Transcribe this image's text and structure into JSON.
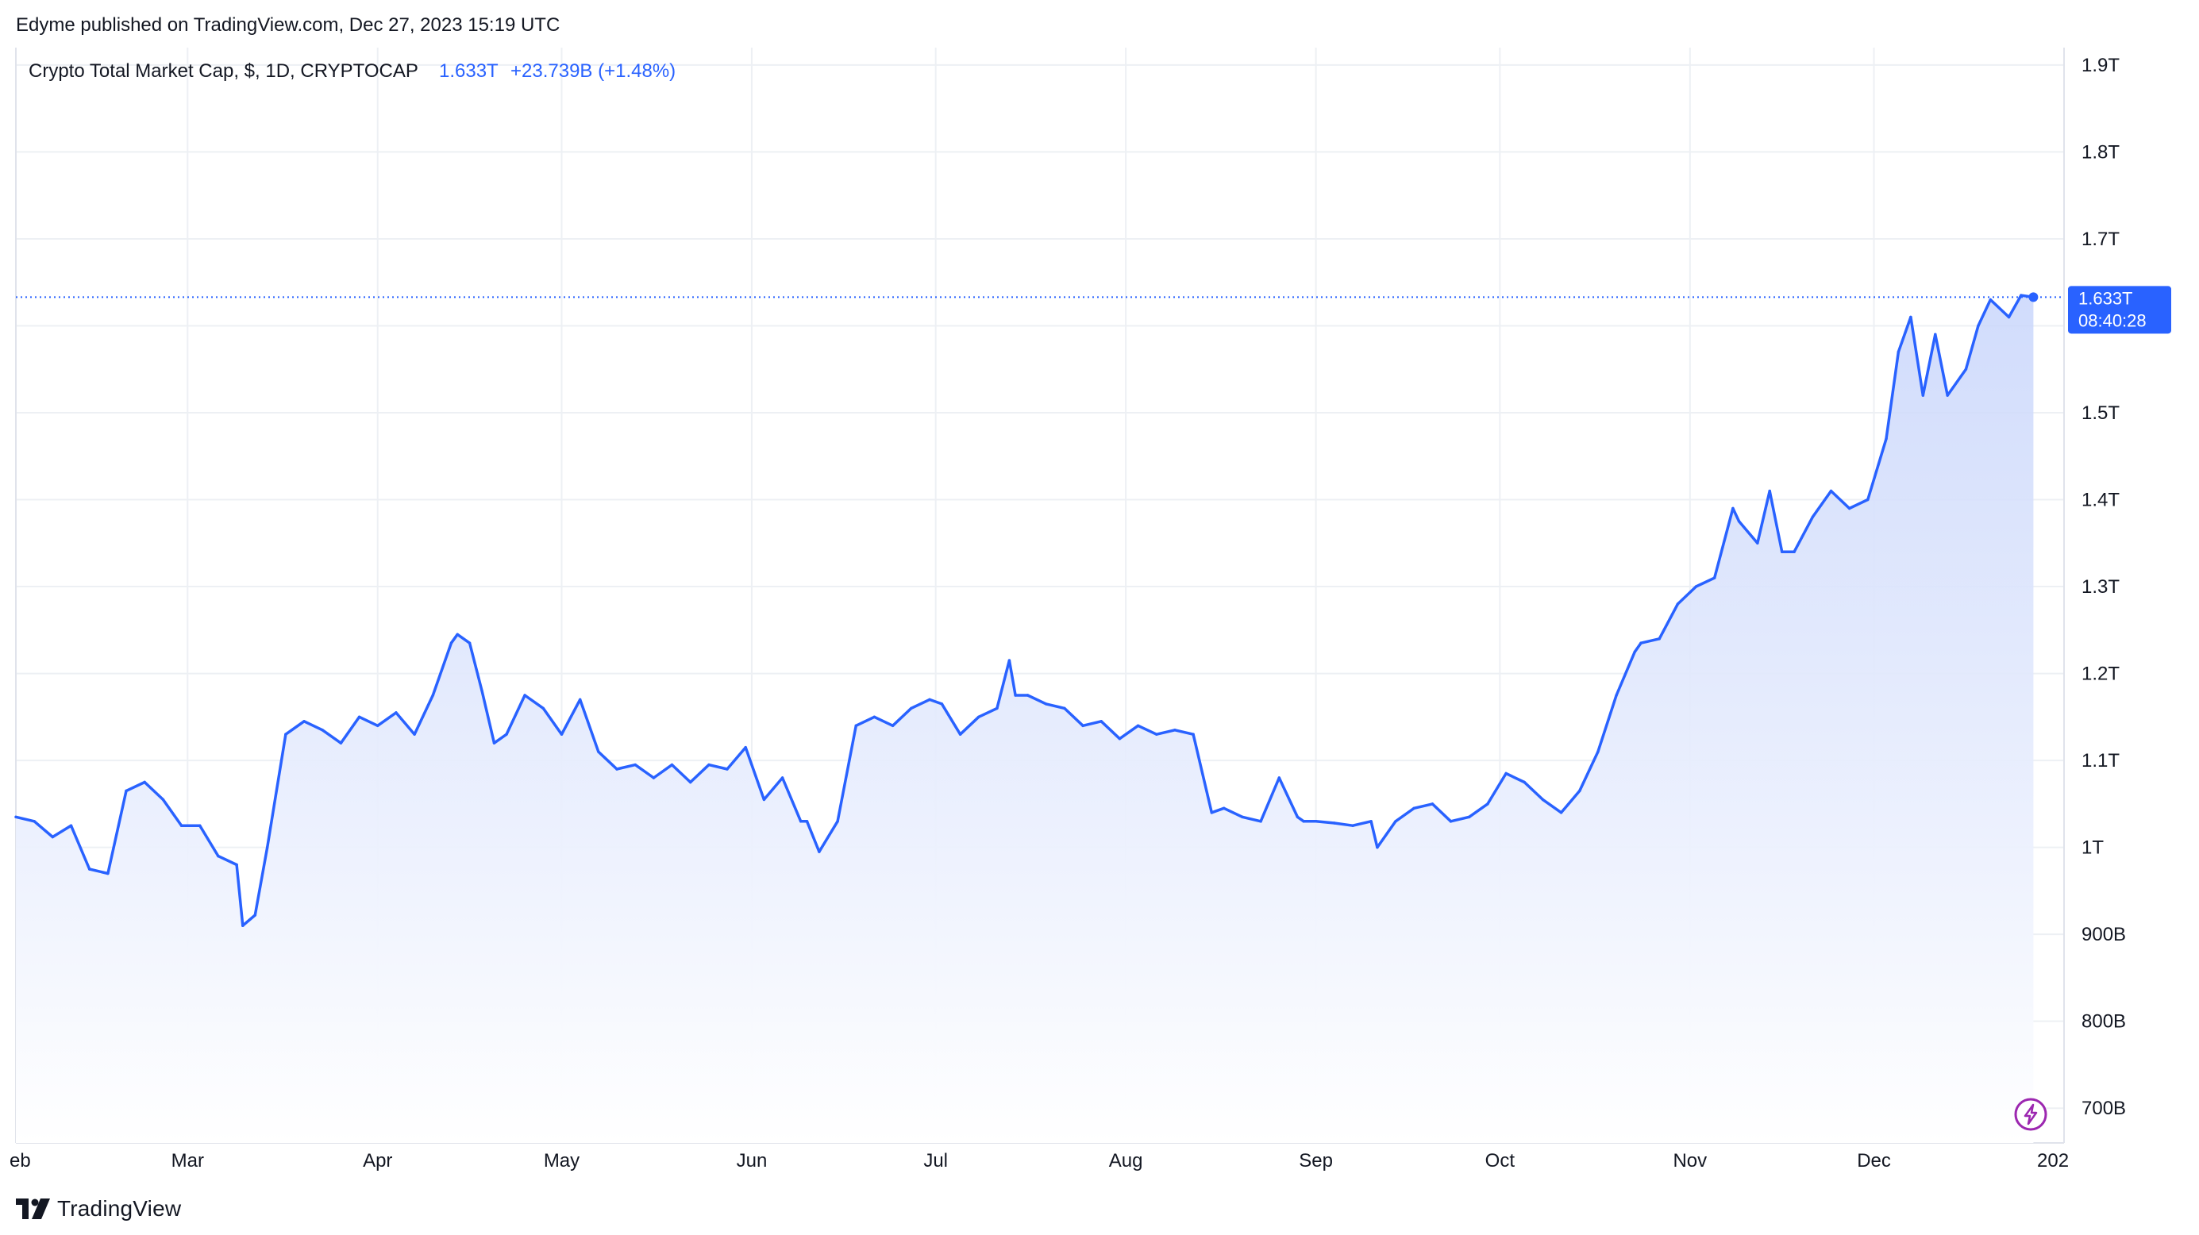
{
  "header": {
    "published": "Edyme published on TradingView.com, Dec 27, 2023 15:19 UTC"
  },
  "legend": {
    "symbol": "Crypto Total Market Cap, $, 1D, CRYPTOCAP",
    "last": "1.633T",
    "change": "+23.739B (+1.48%)"
  },
  "price_label": {
    "value": "1.633T",
    "countdown": "08:40:28"
  },
  "footer": {
    "brand": "TradingView"
  },
  "colors": {
    "line": "#2962FF",
    "fill_top": "#C9D6FB",
    "fill_bottom": "#FFFFFF",
    "grid": "#EDF0F4",
    "axis_text": "#131722",
    "badge": "#2962FF",
    "flash": "#9C27B0"
  },
  "icons": {
    "flash": "lightning-bolt-icon",
    "logo": "tradingview-logo-icon"
  },
  "chart_data": {
    "type": "area",
    "x_ticks": [
      "eb",
      "Mar",
      "Apr",
      "May",
      "Jun",
      "Jul",
      "Aug",
      "Sep",
      "Oct",
      "Nov",
      "Dec",
      "202"
    ],
    "y_ticks": [
      "700B",
      "800B",
      "900B",
      "1T",
      "1.1T",
      "1.2T",
      "1.3T",
      "1.4T",
      "1.5T",
      "1.6T",
      "1.7T",
      "1.8T",
      "1.9T"
    ],
    "y_unit": "USD (trillions)",
    "ylim": [
      0.66,
      1.92
    ],
    "xlim": [
      "2023-02-01",
      "2024-01-01"
    ],
    "last_value": 1.633,
    "grid": true,
    "series": [
      {
        "x": [
          "2023-02-01",
          "2023-02-04",
          "2023-02-07",
          "2023-02-10",
          "2023-02-13",
          "2023-02-16",
          "2023-02-19",
          "2023-02-22",
          "2023-02-25",
          "2023-02-28",
          "2023-03-03",
          "2023-03-06",
          "2023-03-09",
          "2023-03-10",
          "2023-03-12",
          "2023-03-14",
          "2023-03-17",
          "2023-03-20",
          "2023-03-23",
          "2023-03-26",
          "2023-03-29",
          "2023-04-01",
          "2023-04-04",
          "2023-04-07",
          "2023-04-10",
          "2023-04-13",
          "2023-04-14",
          "2023-04-16",
          "2023-04-18",
          "2023-04-20",
          "2023-04-22",
          "2023-04-25",
          "2023-04-28",
          "2023-05-01",
          "2023-05-04",
          "2023-05-07",
          "2023-05-10",
          "2023-05-13",
          "2023-05-16",
          "2023-05-19",
          "2023-05-22",
          "2023-05-25",
          "2023-05-28",
          "2023-05-31",
          "2023-06-03",
          "2023-06-06",
          "2023-06-09",
          "2023-06-10",
          "2023-06-12",
          "2023-06-15",
          "2023-06-18",
          "2023-06-21",
          "2023-06-24",
          "2023-06-27",
          "2023-06-30",
          "2023-07-02",
          "2023-07-05",
          "2023-07-08",
          "2023-07-11",
          "2023-07-13",
          "2023-07-14",
          "2023-07-16",
          "2023-07-19",
          "2023-07-22",
          "2023-07-25",
          "2023-07-28",
          "2023-07-31",
          "2023-08-03",
          "2023-08-06",
          "2023-08-09",
          "2023-08-12",
          "2023-08-15",
          "2023-08-17",
          "2023-08-20",
          "2023-08-23",
          "2023-08-26",
          "2023-08-29",
          "2023-08-30",
          "2023-09-01",
          "2023-09-04",
          "2023-09-07",
          "2023-09-10",
          "2023-09-11",
          "2023-09-14",
          "2023-09-17",
          "2023-09-20",
          "2023-09-23",
          "2023-09-26",
          "2023-09-29",
          "2023-10-02",
          "2023-10-05",
          "2023-10-08",
          "2023-10-11",
          "2023-10-14",
          "2023-10-17",
          "2023-10-20",
          "2023-10-23",
          "2023-10-24",
          "2023-10-27",
          "2023-10-30",
          "2023-11-02",
          "2023-11-05",
          "2023-11-08",
          "2023-11-09",
          "2023-11-12",
          "2023-11-14",
          "2023-11-16",
          "2023-11-18",
          "2023-11-21",
          "2023-11-24",
          "2023-11-27",
          "2023-11-30",
          "2023-12-03",
          "2023-12-05",
          "2023-12-07",
          "2023-12-09",
          "2023-12-11",
          "2023-12-13",
          "2023-12-16",
          "2023-12-18",
          "2023-12-20",
          "2023-12-23",
          "2023-12-25",
          "2023-12-27"
        ],
        "values": [
          1.035,
          1.03,
          1.012,
          1.025,
          0.975,
          0.97,
          1.065,
          1.075,
          1.055,
          1.025,
          1.025,
          0.99,
          0.98,
          0.91,
          0.922,
          1.0,
          1.13,
          1.145,
          1.135,
          1.12,
          1.15,
          1.14,
          1.155,
          1.13,
          1.175,
          1.235,
          1.245,
          1.235,
          1.18,
          1.12,
          1.13,
          1.175,
          1.16,
          1.13,
          1.17,
          1.11,
          1.09,
          1.095,
          1.08,
          1.095,
          1.075,
          1.095,
          1.09,
          1.115,
          1.055,
          1.08,
          1.03,
          1.03,
          0.995,
          1.03,
          1.14,
          1.15,
          1.14,
          1.16,
          1.17,
          1.165,
          1.13,
          1.15,
          1.16,
          1.215,
          1.175,
          1.175,
          1.165,
          1.16,
          1.14,
          1.145,
          1.125,
          1.14,
          1.13,
          1.135,
          1.13,
          1.04,
          1.045,
          1.035,
          1.03,
          1.08,
          1.035,
          1.03,
          1.03,
          1.028,
          1.025,
          1.03,
          1.0,
          1.03,
          1.045,
          1.05,
          1.03,
          1.035,
          1.05,
          1.085,
          1.075,
          1.055,
          1.04,
          1.065,
          1.11,
          1.175,
          1.225,
          1.235,
          1.24,
          1.28,
          1.3,
          1.31,
          1.39,
          1.375,
          1.35,
          1.41,
          1.34,
          1.34,
          1.38,
          1.41,
          1.39,
          1.4,
          1.47,
          1.57,
          1.61,
          1.52,
          1.59,
          1.52,
          1.55,
          1.6,
          1.63,
          1.61,
          1.635,
          1.633
        ]
      }
    ]
  }
}
